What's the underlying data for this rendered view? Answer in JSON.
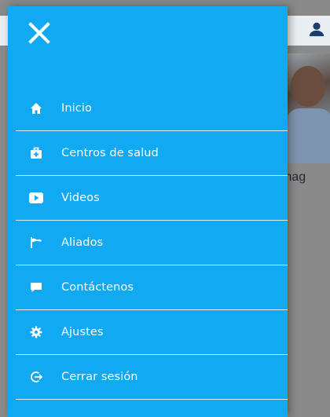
{
  "drawer": {
    "background_color": "#12a9f3",
    "close_icon": "close-icon",
    "items": [
      {
        "label": "Inicio",
        "icon": "home-icon"
      },
      {
        "label": "Centros de salud",
        "icon": "medical-kit-icon"
      },
      {
        "label": "Videos",
        "icon": "video-icon"
      },
      {
        "label": "Aliados",
        "icon": "flag-icon"
      },
      {
        "label": "Contáctenos",
        "icon": "chat-icon"
      },
      {
        "label": "Ajustes",
        "icon": "gear-icon"
      },
      {
        "label": "Cerrar sesión",
        "icon": "logout-icon"
      }
    ]
  },
  "background": {
    "user_icon": "user-icon",
    "visible_text": "mag"
  }
}
